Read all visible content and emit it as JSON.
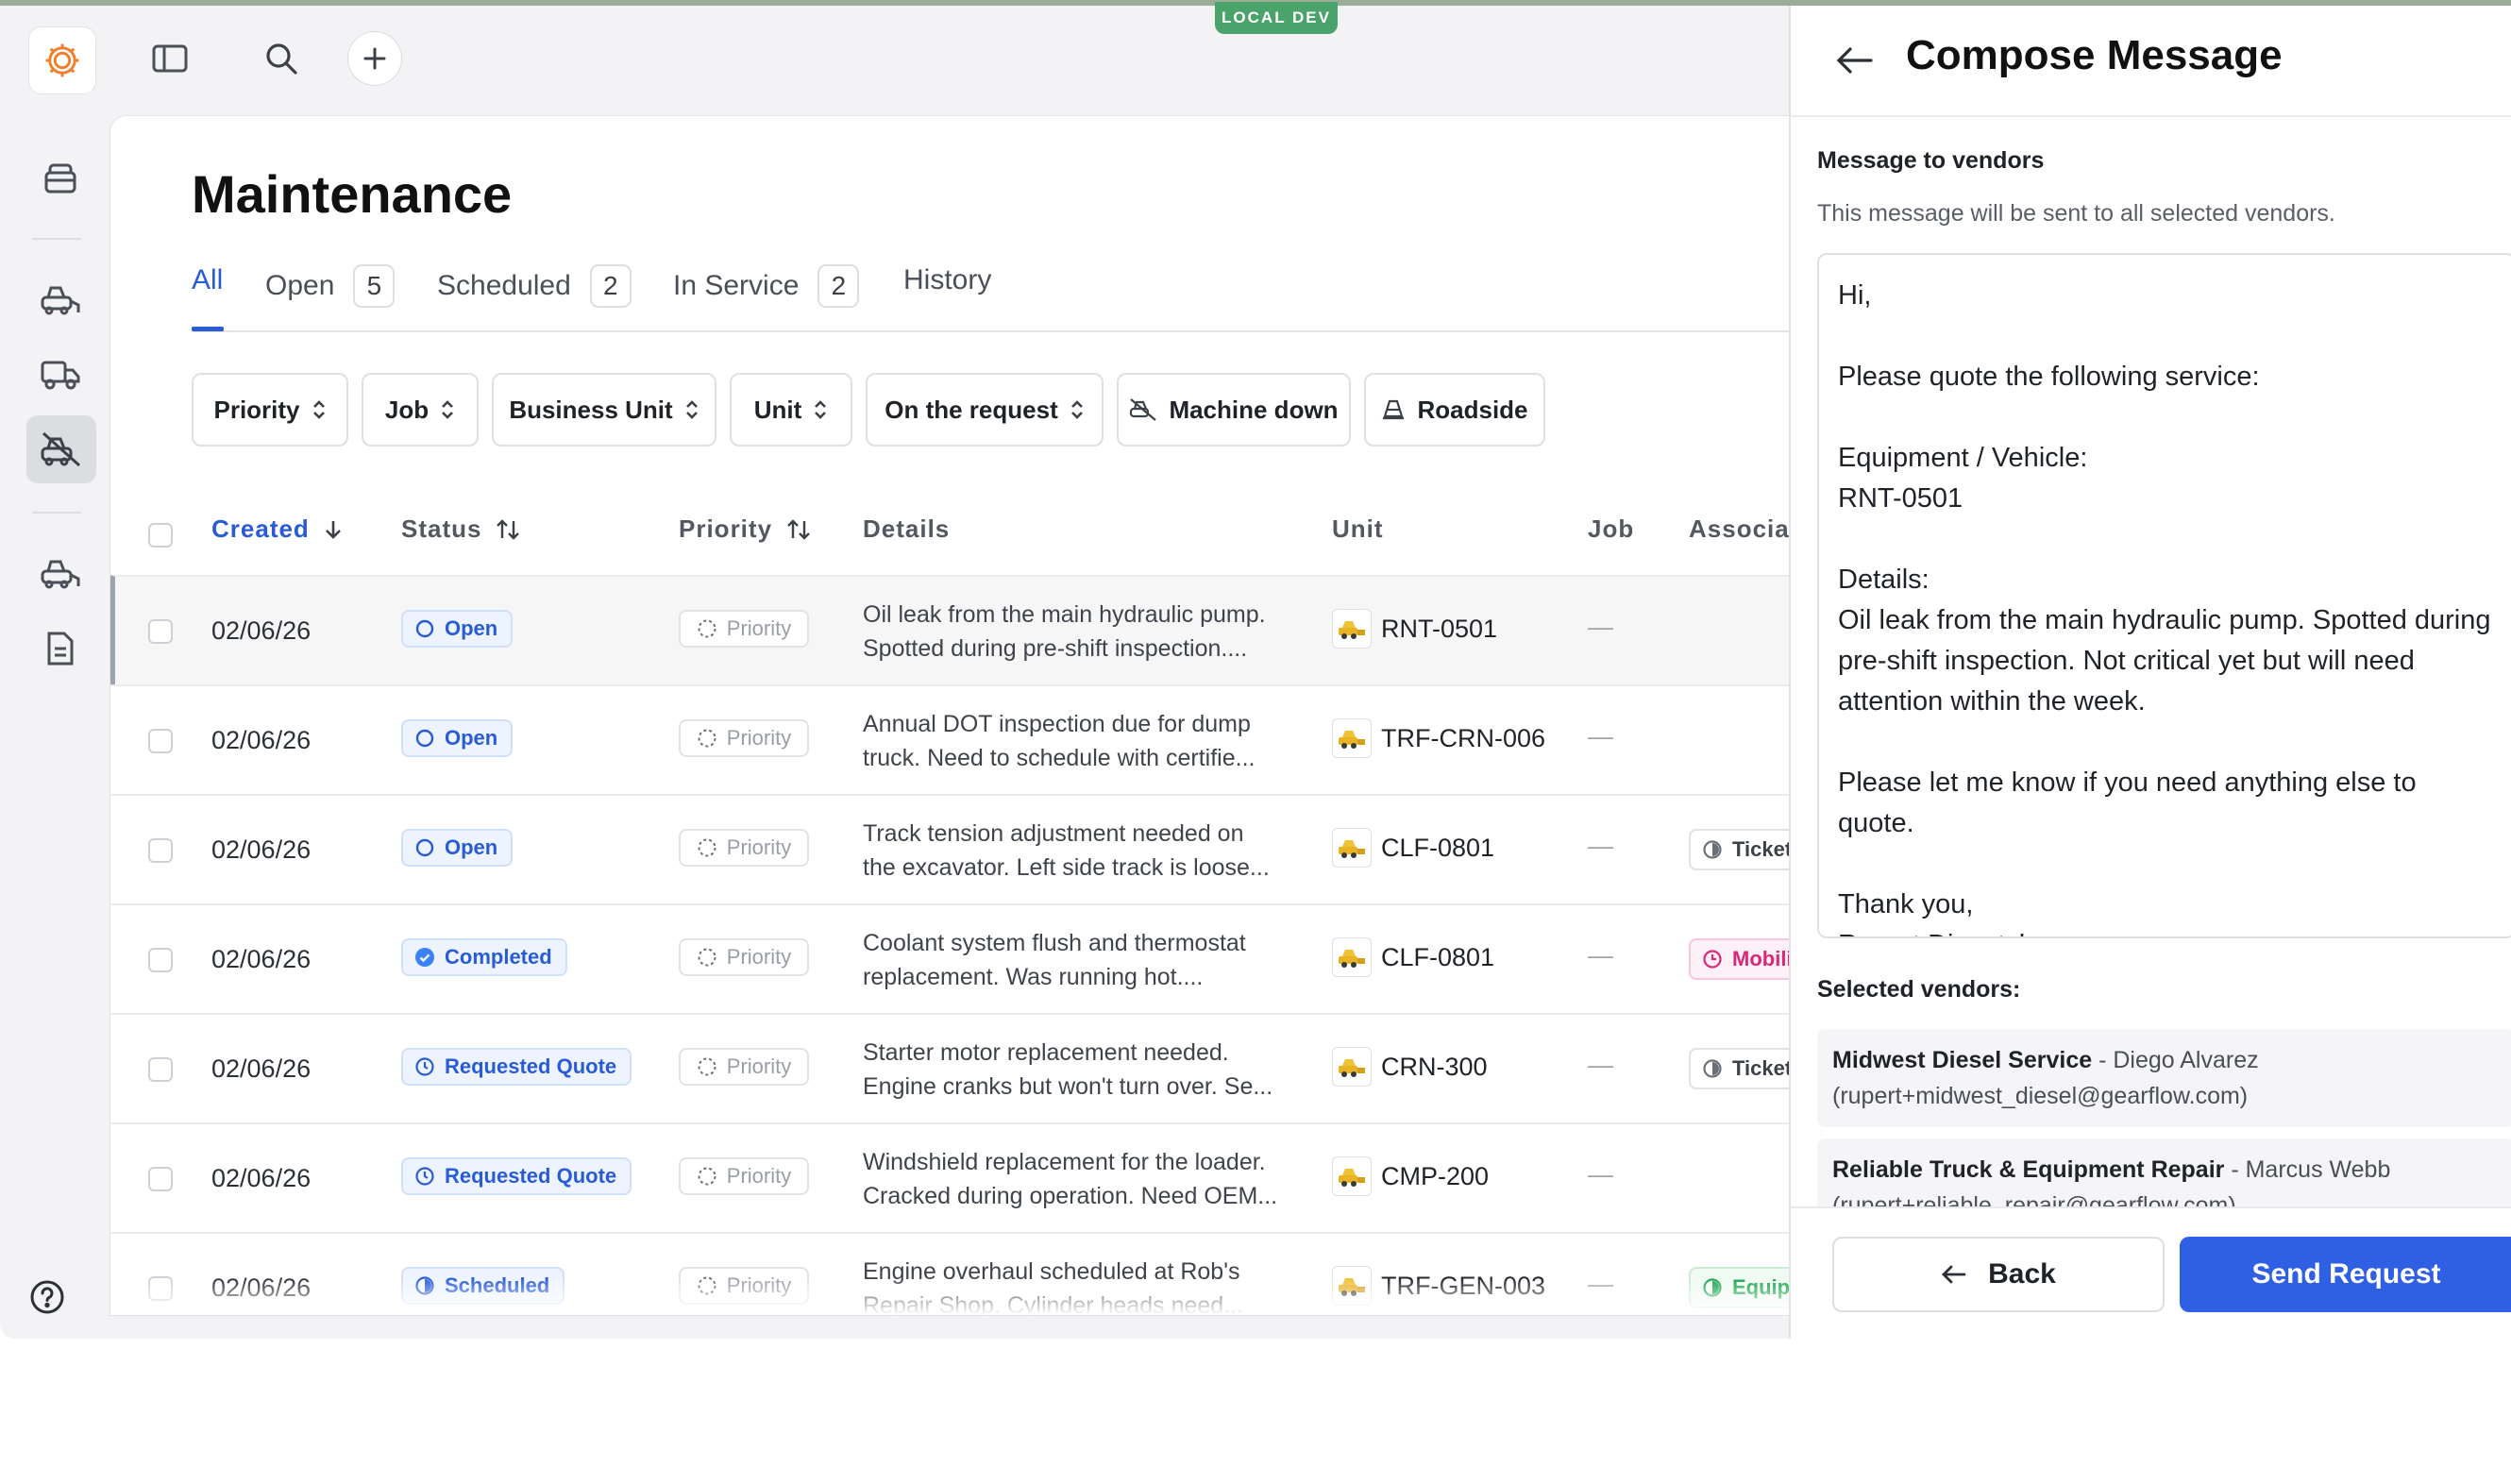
{
  "environment_badge": "LOCAL DEV",
  "page": {
    "title": "Maintenance"
  },
  "tabs": [
    {
      "label": "All",
      "count": null
    },
    {
      "label": "Open",
      "count": "5"
    },
    {
      "label": "Scheduled",
      "count": "2"
    },
    {
      "label": "In Service",
      "count": "2"
    },
    {
      "label": "History",
      "count": null
    }
  ],
  "filters": [
    "Priority",
    "Job",
    "Business Unit",
    "Unit",
    "On the request",
    "Machine down",
    "Roadside"
  ],
  "table": {
    "columns": [
      "Created",
      "Status",
      "Priority",
      "Details",
      "Unit",
      "Job",
      "Associat"
    ],
    "rows": [
      {
        "created": "02/06/26",
        "status": "Open",
        "priority": "Priority",
        "details_line1": "Oil leak from the main hydraulic pump.",
        "details_line2": "Spotted during pre-shift inspection....",
        "unit": "RNT-0501",
        "job": "—",
        "assoc": ""
      },
      {
        "created": "02/06/26",
        "status": "Open",
        "priority": "Priority",
        "details_line1": "Annual DOT inspection due for dump",
        "details_line2": "truck. Need to schedule with certifie...",
        "unit": "TRF-CRN-006",
        "job": "—",
        "assoc": ""
      },
      {
        "created": "02/06/26",
        "status": "Open",
        "priority": "Priority",
        "details_line1": "Track tension adjustment needed on",
        "details_line2": "the excavator. Left side track is loose...",
        "unit": "CLF-0801",
        "job": "—",
        "assoc": "Ticket"
      },
      {
        "created": "02/06/26",
        "status": "Completed",
        "priority": "Priority",
        "details_line1": "Coolant system flush and thermostat",
        "details_line2": "replacement. Was running hot....",
        "unit": "CLF-0801",
        "job": "—",
        "assoc": "Mobili"
      },
      {
        "created": "02/06/26",
        "status": "Requested Quote",
        "priority": "Priority",
        "details_line1": "Starter motor replacement needed.",
        "details_line2": "Engine cranks but won't turn over. Se...",
        "unit": "CRN-300",
        "job": "—",
        "assoc": "Ticket"
      },
      {
        "created": "02/06/26",
        "status": "Requested Quote",
        "priority": "Priority",
        "details_line1": "Windshield replacement for the loader.",
        "details_line2": "Cracked during operation. Need OEM...",
        "unit": "CMP-200",
        "job": "—",
        "assoc": ""
      },
      {
        "created": "02/06/26",
        "status": "Scheduled",
        "priority": "Priority",
        "details_line1": "Engine overhaul scheduled at Rob's",
        "details_line2": "Repair Shop. Cylinder heads need...",
        "unit": "TRF-GEN-003",
        "job": "—",
        "assoc": "Equip"
      }
    ]
  },
  "panel": {
    "title": "Compose Message",
    "message_label": "Message to vendors",
    "helper": "This message will be sent to all selected vendors.",
    "message": "Hi,\n\nPlease quote the following service:\n\nEquipment / Vehicle:\nRNT-0501\n\nDetails:\nOil leak from the main hydraulic pump. Spotted during pre-shift inspection. Not critical yet but will need attention within the week.\n\nPlease let me know if you need anything else to quote.\n\nThank you,\nRupert Dispatcher",
    "selected_label": "Selected vendors:",
    "vendors": [
      {
        "name": "Midwest Diesel Service",
        "contact": " - Diego Alvarez",
        "email": "(rupert+midwest_diesel@gearflow.com)"
      },
      {
        "name": "Reliable Truck & Equipment Repair",
        "contact": " - Marcus Webb",
        "email": "(rupert+reliable_repair@gearflow.com)"
      }
    ],
    "back_label": "Back",
    "send_label": "Send Request"
  },
  "colors": {
    "accent": "#2a5bd7",
    "primary_button": "#2f5fe3",
    "completed": "#3b82f6",
    "mobile": "#db2777",
    "equipment": "#16a34a"
  }
}
